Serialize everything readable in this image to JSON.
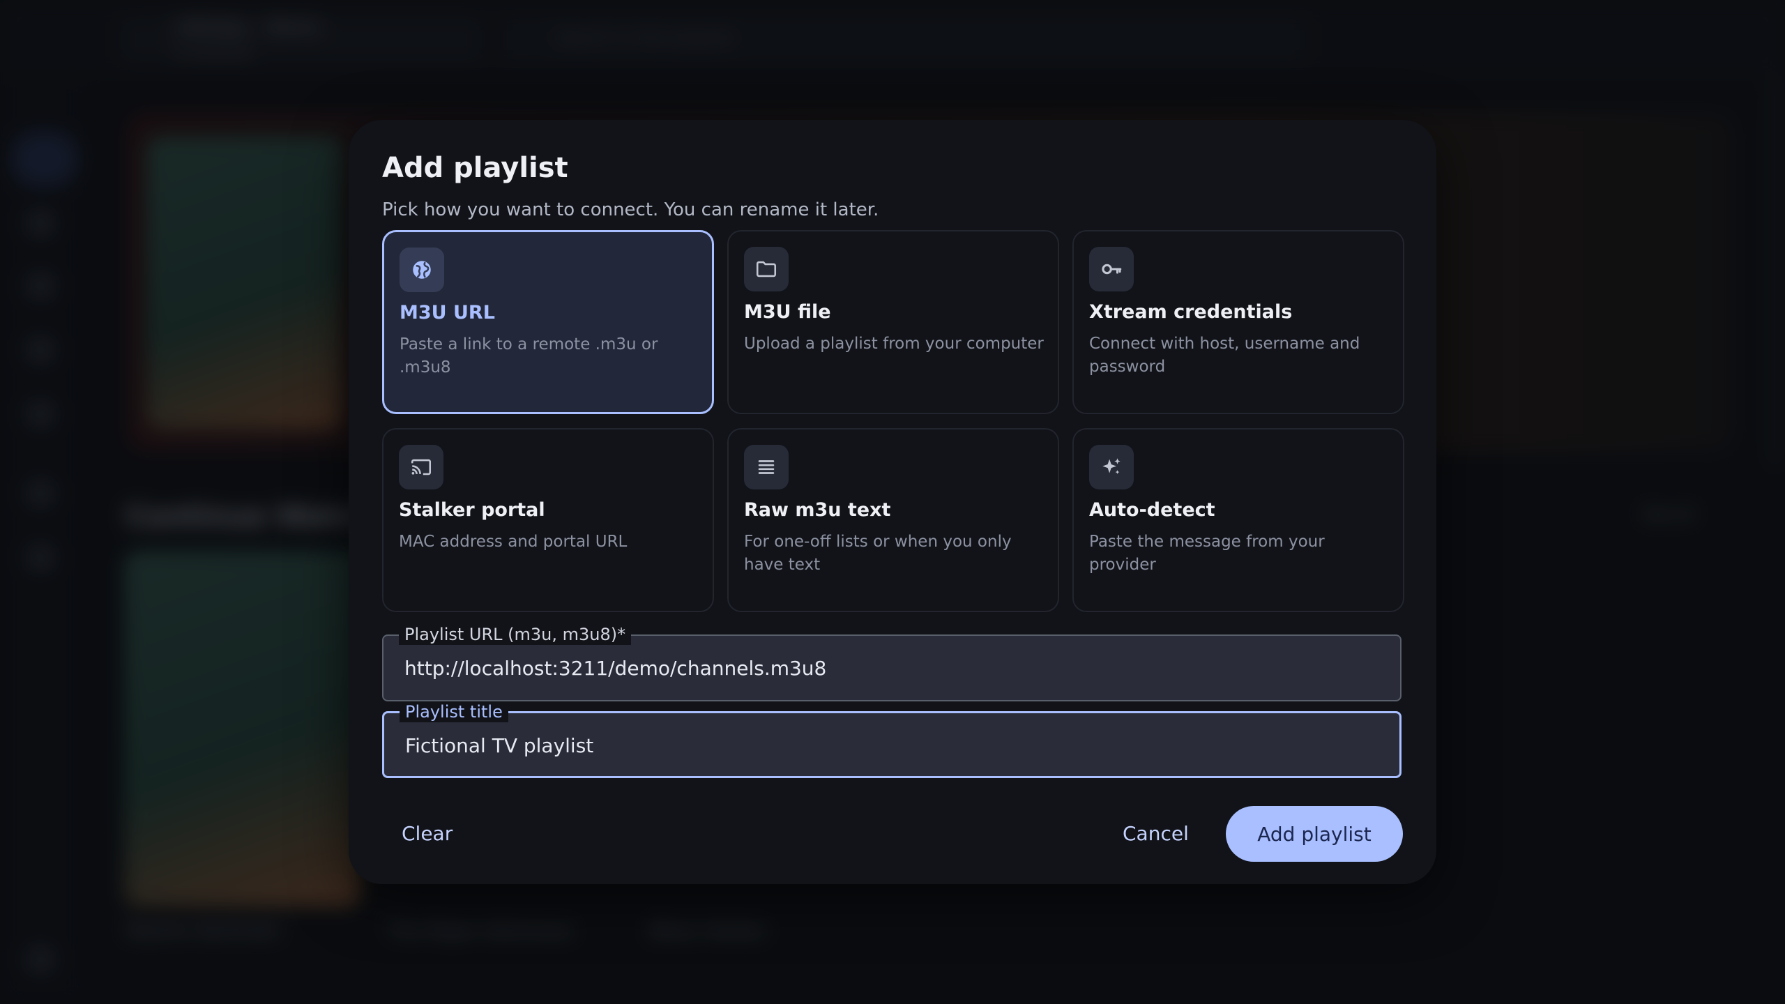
{
  "background": {
    "app_title": "Infinitex · Demo",
    "app_subtitle": "6 channels",
    "search_placeholder": "Search in this playlist",
    "section_heading": "Continue Watching",
    "see_all": "See all",
    "captions": [
      "Skyline Sentinels",
      "The Paper Astronaut",
      "Black Harbor"
    ]
  },
  "dialog": {
    "title": "Add playlist",
    "subtitle": "Pick how you want to connect. You can rename it later.",
    "options": [
      {
        "title": "M3U URL",
        "description": "Paste a link to a remote .m3u or .m3u8",
        "icon": "globe-icon",
        "selected": true
      },
      {
        "title": "M3U file",
        "description": "Upload a playlist from your computer",
        "icon": "folder-icon",
        "selected": false
      },
      {
        "title": "Xtream credentials",
        "description": "Connect with host, username and password",
        "icon": "key-icon",
        "selected": false
      },
      {
        "title": "Stalker portal",
        "description": "MAC address and portal URL",
        "icon": "cast-icon",
        "selected": false
      },
      {
        "title": "Raw m3u text",
        "description": "For one-off lists or when you only have text",
        "icon": "text-lines-icon",
        "selected": false
      },
      {
        "title": "Auto-detect",
        "description": "Paste the message from your provider",
        "icon": "sparkle-icon",
        "selected": false
      }
    ],
    "url_field": {
      "label": "Playlist URL (m3u, m3u8)*",
      "value": "http://localhost:3211/demo/channels.m3u8"
    },
    "title_field": {
      "label": "Playlist title",
      "value": "Fictional TV playlist"
    },
    "buttons": {
      "clear": "Clear",
      "cancel": "Cancel",
      "submit": "Add playlist"
    }
  },
  "colors": {
    "accent": "#a9bfff",
    "dialog_bg": "#111318",
    "selected_card_bg": "#22283a",
    "input_bg": "#2a2d39"
  }
}
